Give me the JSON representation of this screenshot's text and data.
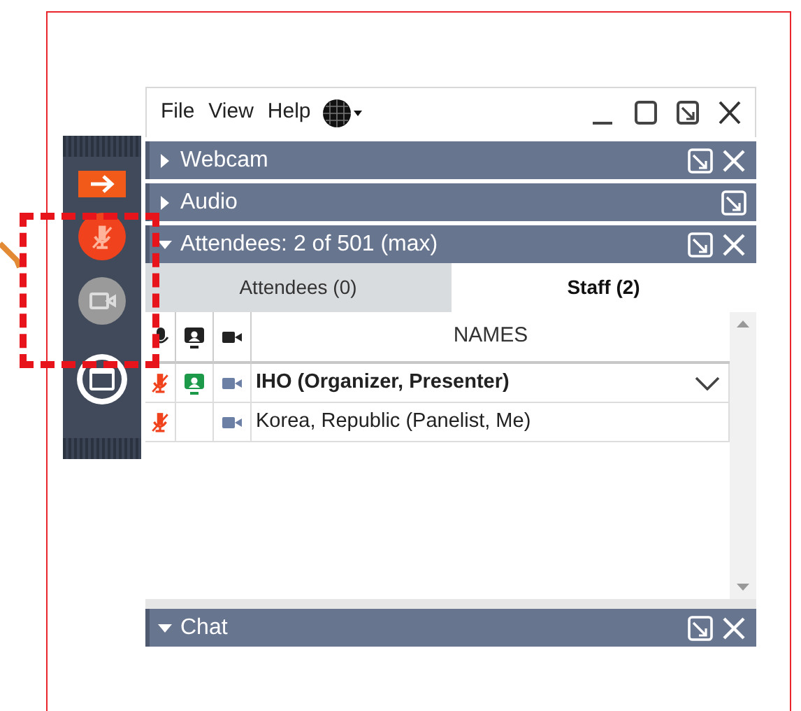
{
  "menu": [
    {
      "label": "File"
    },
    {
      "label": "View"
    },
    {
      "label": "Help"
    }
  ],
  "sidebar": [
    {
      "kind": "arrow"
    },
    {
      "kind": "mic"
    },
    {
      "kind": "camera"
    },
    {
      "kind": "window"
    }
  ],
  "panels": [
    {
      "title": "Webcam",
      "expanded": false,
      "closable": true
    },
    {
      "title": "Audio",
      "expanded": false,
      "closable": false
    },
    {
      "title": "Attendees: 2 of 501 (max)",
      "expanded": true,
      "closable": true
    }
  ],
  "tabs": [
    {
      "label": "Attendees (0)",
      "selected": false
    },
    {
      "label": "Staff (2)",
      "selected": true
    }
  ],
  "names_header": "NAMES",
  "rows": [
    {
      "name": "IHO (Organizer, Presenter)",
      "bold": true,
      "presenter": true,
      "expandable": true
    },
    {
      "name": "Korea, Republic (Panelist, Me)",
      "bold": false,
      "presenter": false,
      "expandable": false
    }
  ],
  "chat": {
    "title": "Chat",
    "expanded": true,
    "closable": true
  }
}
